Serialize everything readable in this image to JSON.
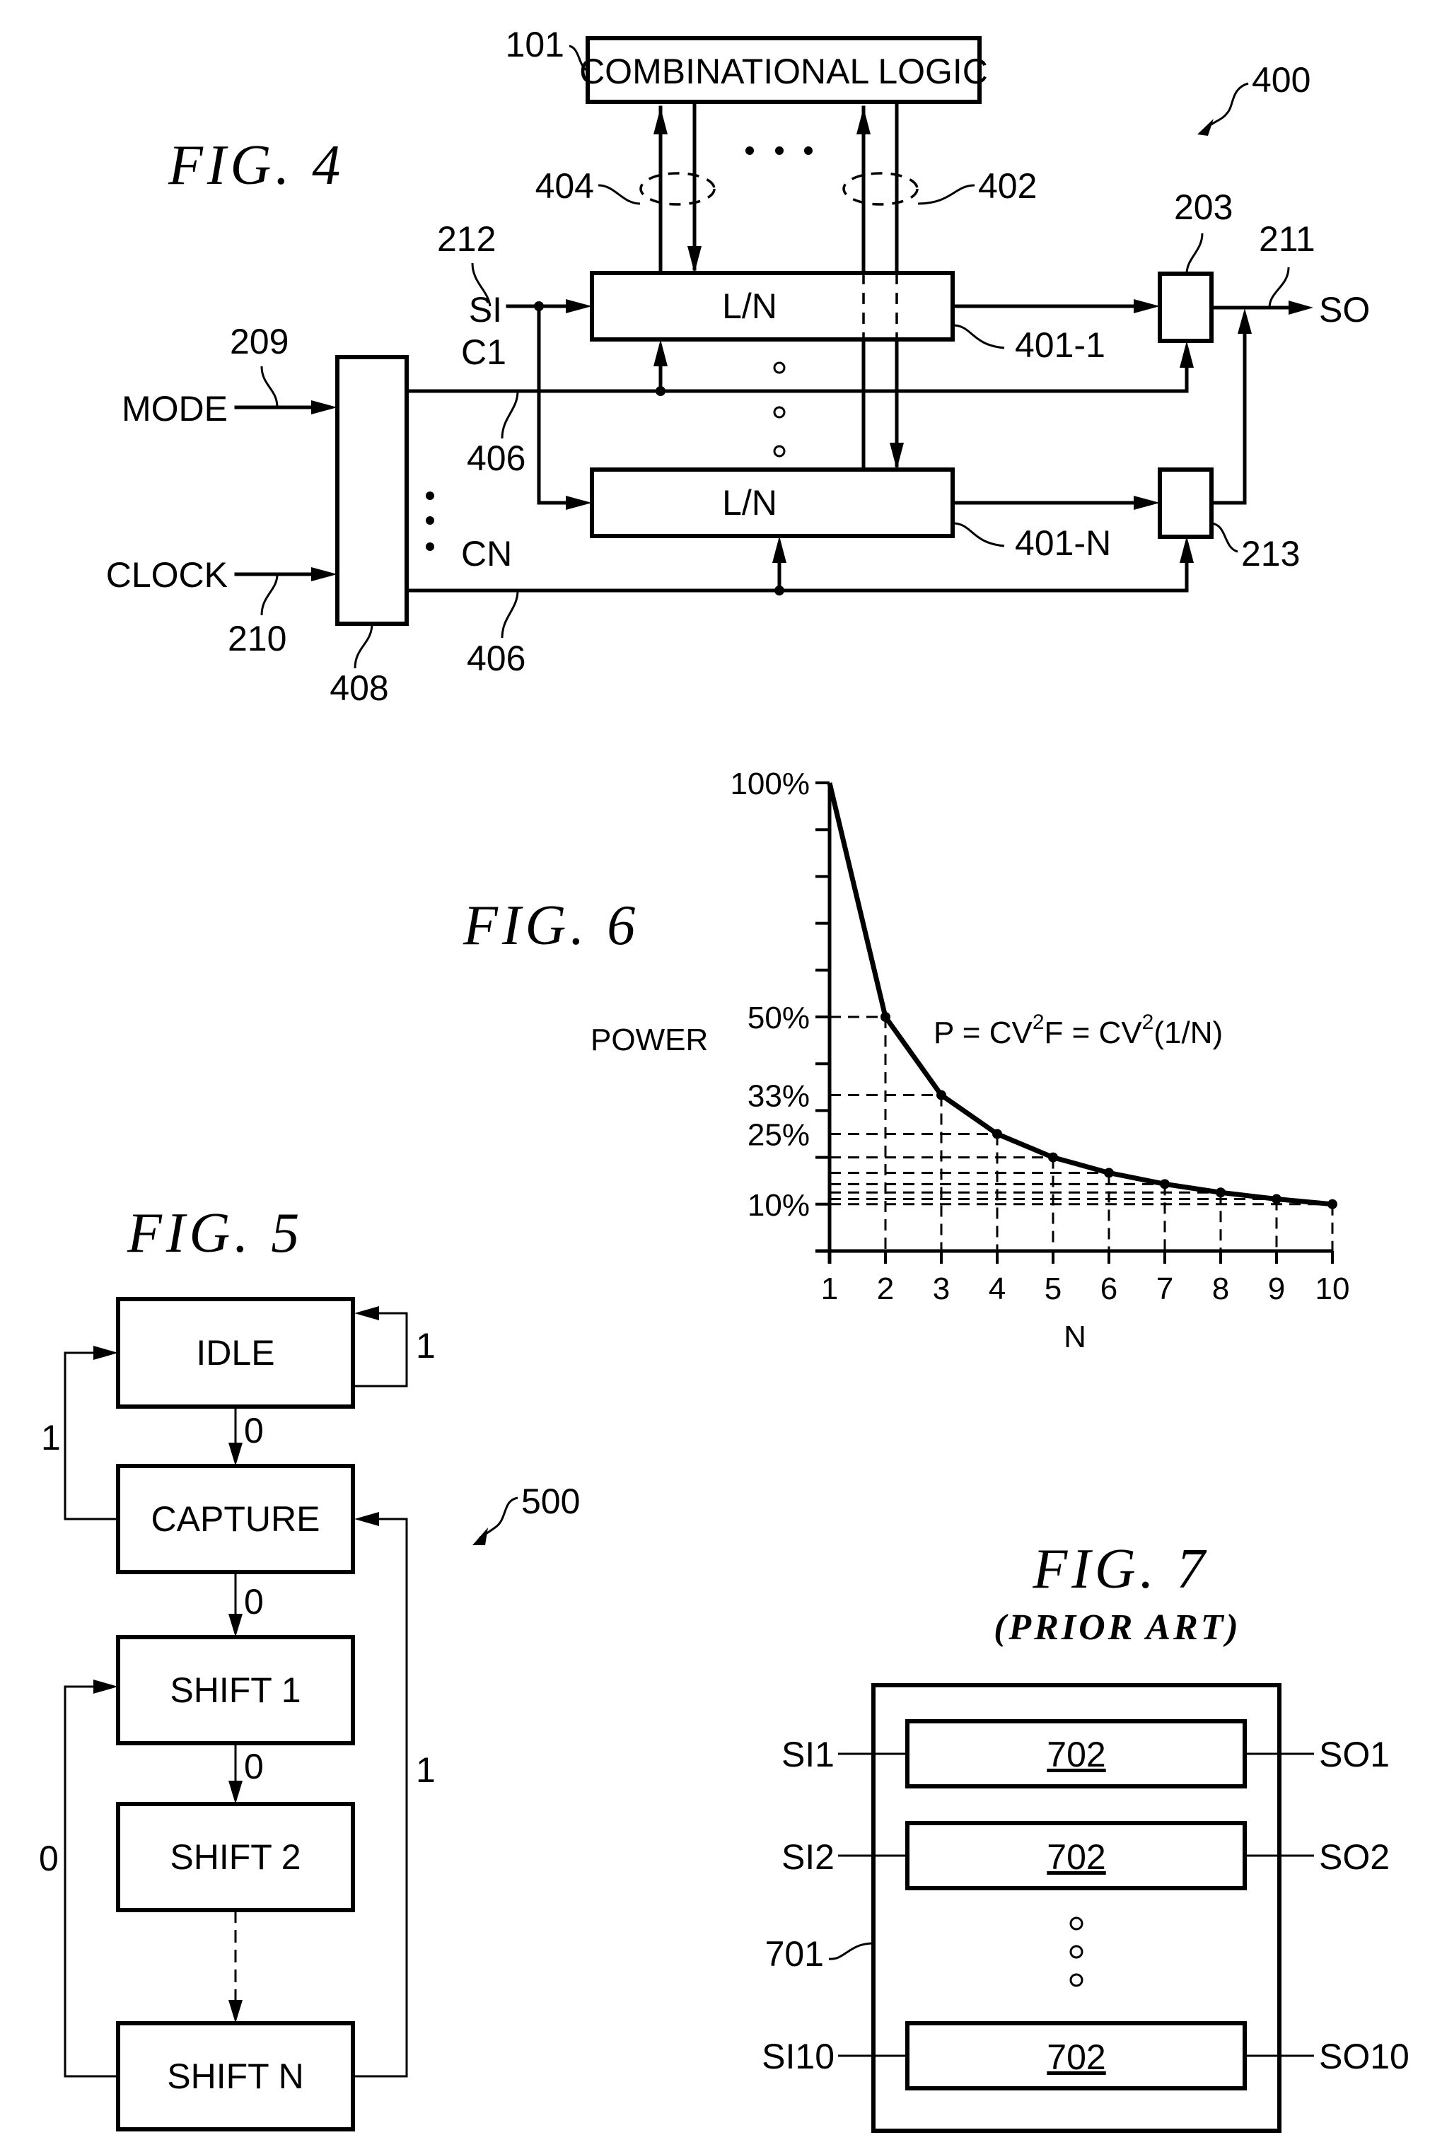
{
  "fig4": {
    "title": "FIG. 4",
    "ref_400": "400",
    "combo_logic": {
      "label": "COMBINATIONAL LOGIC",
      "ref": "101"
    },
    "bus_refs": {
      "left": "404",
      "right": "402"
    },
    "ellipsis": "• • •",
    "si": {
      "label": "SI",
      "ref": "212"
    },
    "so": {
      "label": "SO",
      "ref": "211"
    },
    "mode": {
      "label": "MODE",
      "ref": "209"
    },
    "clock": {
      "label": "CLOCK",
      "ref": "210"
    },
    "controller_ref": "408",
    "clock_lines": [
      {
        "label": "C1",
        "ref": "406"
      },
      {
        "label": "CN",
        "ref": "406"
      }
    ],
    "chains": [
      {
        "label": "L/N",
        "ref": "401-1"
      },
      {
        "label": "L/N",
        "ref": "401-N"
      }
    ],
    "mux_refs": {
      "top": "203",
      "bottom": "213"
    }
  },
  "fig5": {
    "title": "FIG. 5",
    "ref": "500",
    "states": [
      "IDLE",
      "CAPTURE",
      "SHIFT 1",
      "SHIFT 2",
      "SHIFT N"
    ],
    "transitions": {
      "idle_self": "1",
      "idle_to_capture": "0",
      "capture_to_idle": "1",
      "capture_to_shift1": "0",
      "shift1_to_shift2": "0",
      "shiftn_to_shift1": "0",
      "shiftn_to_capture": "1"
    }
  },
  "fig6": {
    "title": "FIG. 6"
  },
  "chart_data": {
    "type": "line",
    "title": "FIG. 6",
    "xlabel": "N",
    "ylabel": "POWER",
    "annotation": "P = CV²F = CV²(1/N)",
    "annotation_parts": {
      "p": "P = CV",
      "sup1": "2",
      "f": "F = CV",
      "sup2": "2",
      "tail": "(1/N)"
    },
    "x": [
      1,
      2,
      3,
      4,
      5,
      6,
      7,
      8,
      9,
      10
    ],
    "x_tick_labels": [
      "1",
      "2",
      "3",
      "4",
      "5",
      "6",
      "7",
      "8",
      "9",
      "10"
    ],
    "series": [
      {
        "name": "Power",
        "values": [
          100,
          50,
          33.3,
          25,
          20,
          16.7,
          14.3,
          12.5,
          11.1,
          10
        ]
      }
    ],
    "y_tick_labels": [
      {
        "value": 100,
        "label": "100%"
      },
      {
        "value": 50,
        "label": "50%"
      },
      {
        "value": 33.3,
        "label": "33%"
      },
      {
        "value": 25,
        "label": "25%"
      },
      {
        "value": 10,
        "label": "10%"
      }
    ],
    "y_minor_ticks": [
      10,
      20,
      30,
      40,
      50,
      60,
      70,
      80,
      90,
      100
    ],
    "xlim": [
      1,
      10
    ],
    "ylim": [
      0,
      100
    ],
    "grid": "dashed drop lines to each point",
    "legend": "none"
  },
  "fig7": {
    "title": "FIG. 7",
    "subtitle": "(PRIOR ART)",
    "outer_ref": "701",
    "blocks": [
      {
        "label": "702",
        "in": "SI1",
        "out": "SO1"
      },
      {
        "label": "702",
        "in": "SI2",
        "out": "SO2"
      },
      {
        "label": "702",
        "in": "SI10",
        "out": "SO10"
      }
    ]
  }
}
